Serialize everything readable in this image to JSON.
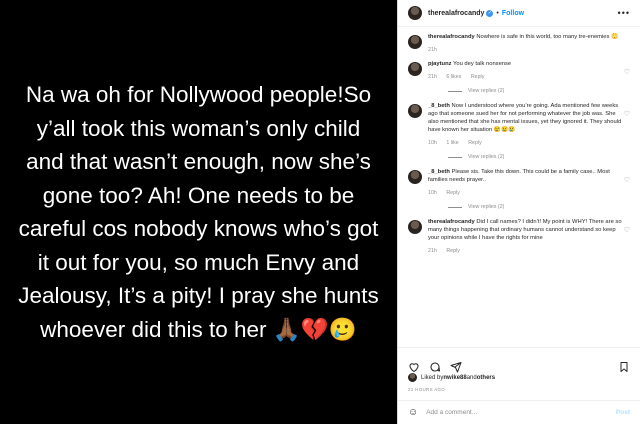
{
  "media": {
    "text": "Na wa oh for Nollywood people!So y’all took this woman’s only child and that wasn’t enough, now she’s gone too? Ah! One needs to be careful cos nobody knows who’s got it out for you, so much Envy and Jealousy, It’s a pity! I pray she hunts whoever did this to her 🙏🏾💔🥲"
  },
  "header": {
    "username": "therealafrocandy",
    "follow": "Follow",
    "dot": "•",
    "more": "•••"
  },
  "comments": [
    {
      "user": "therealafrocandy",
      "text": "Nowhere is safe in this world, too many tre-enemies 😳",
      "time": "21h",
      "likes": "",
      "reply": "",
      "replies": ""
    },
    {
      "user": "pjaytunz",
      "text": "You dey talk nonsense",
      "time": "21h",
      "likes": "6 likes",
      "reply": "Reply",
      "replies": "View replies (2)"
    },
    {
      "user": "_8_beth",
      "text": "Now I understood where you’re going. Ada mentioned few weeks ago that someone sued her for not performing whatever the job was. She also mentioned that she has mental issues, yet they ignored it. They should have known her situation 😢😢😢",
      "time": "10h",
      "likes": "1 like",
      "reply": "Reply",
      "replies": "View replies (2)"
    },
    {
      "user": "_8_beth",
      "text": "Please sis. Take this down. This could be a family case.. Most families needs prayer..",
      "time": "10h",
      "likes": "",
      "reply": "Reply",
      "replies": "View replies (2)"
    },
    {
      "user": "therealafrocandy",
      "text": "Did I call names? I didn’t! My point is WHY! There are so many things happening that ordinary humans cannot understand so keep your opinions while I have the rights for mine",
      "time": "21h",
      "likes": "",
      "reply": "Reply",
      "replies": ""
    }
  ],
  "likes": {
    "prefix": "Liked by ",
    "user": "nwike88",
    "mid": " and ",
    "others": "others"
  },
  "time": "21 HOURS AGO",
  "add_comment": {
    "placeholder": "Add a comment...",
    "post": "Post"
  }
}
